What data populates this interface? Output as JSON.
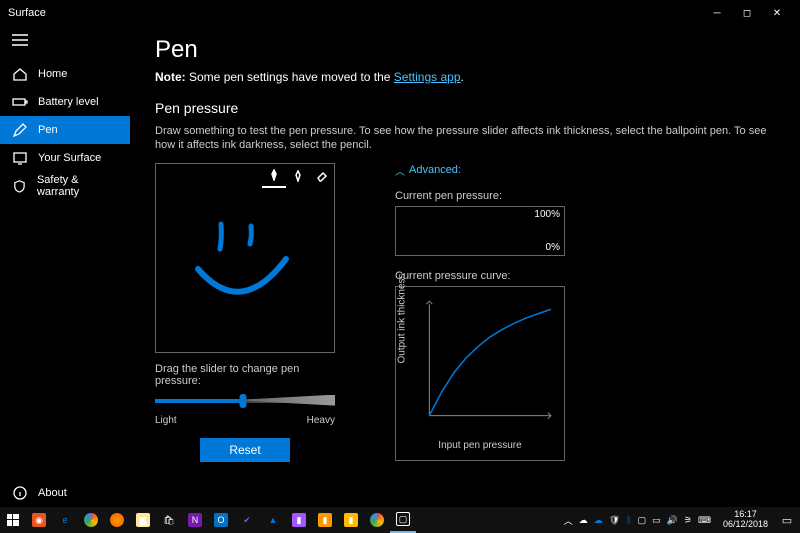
{
  "window": {
    "title": "Surface"
  },
  "sidebar": {
    "items": [
      {
        "label": "Home"
      },
      {
        "label": "Battery level"
      },
      {
        "label": "Pen"
      },
      {
        "label": "Your Surface"
      },
      {
        "label": "Safety & warranty"
      }
    ],
    "footer": {
      "label": "About"
    }
  },
  "page": {
    "title": "Pen",
    "note_prefix": "Note:",
    "note_text": " Some pen settings have moved to the ",
    "note_link": "Settings app",
    "note_suffix": ".",
    "section_title": "Pen pressure",
    "instructions": "Draw something to test the pen pressure. To see how the pressure slider affects ink thickness, select the ballpoint pen. To see how it affects ink darkness, select the pencil.",
    "slider_label": "Drag the slider to change pen pressure:",
    "slider_min_label": "Light",
    "slider_max_label": "Heavy",
    "reset_label": "Reset",
    "advanced_label": "Advanced:",
    "pressure_label": "Current pen pressure:",
    "pressure_max": "100%",
    "pressure_min": "0%",
    "curve_label": "Current pressure curve:",
    "curve_ylabel": "Output ink thickness",
    "curve_xlabel": "Input pen pressure"
  },
  "taskbar": {
    "clock_time": "16:17",
    "clock_date": "06/12/2018"
  },
  "chart_data": {
    "type": "line",
    "title": "Current pressure curve",
    "xlabel": "Input pen pressure",
    "ylabel": "Output ink thickness",
    "xlim": [
      0,
      1
    ],
    "ylim": [
      0,
      1
    ],
    "x": [
      0.0,
      0.1,
      0.2,
      0.3,
      0.4,
      0.5,
      0.6,
      0.7,
      0.8,
      0.9,
      1.0
    ],
    "values": [
      0.0,
      0.22,
      0.4,
      0.54,
      0.65,
      0.74,
      0.81,
      0.87,
      0.92,
      0.96,
      1.0
    ]
  }
}
